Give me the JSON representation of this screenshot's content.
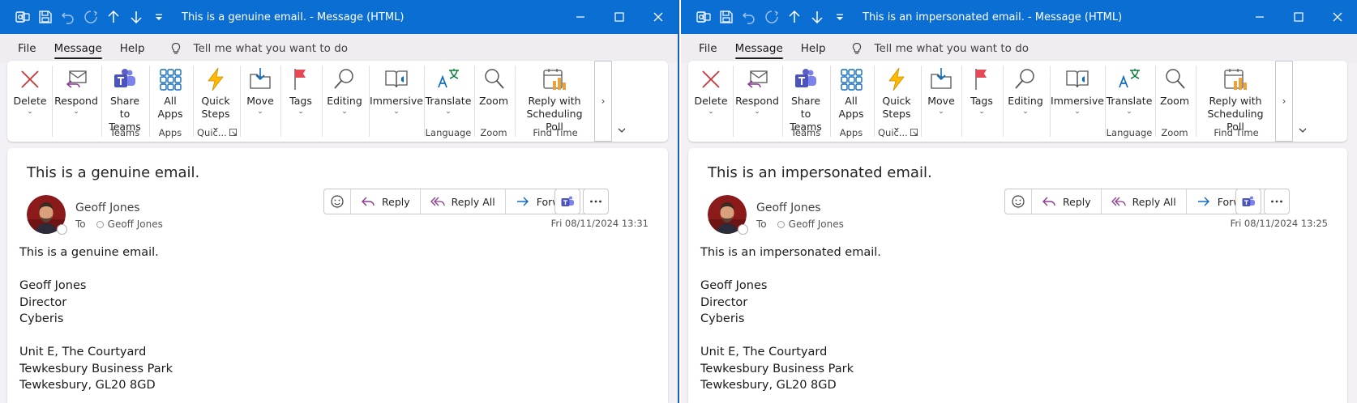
{
  "colors": {
    "titlebar": "#0b6ed3",
    "accent": "#0f6cbd",
    "delete_red": "#d13438",
    "teams_purple": "#5b5fc7"
  },
  "windows": [
    {
      "title": "This is a genuine email.  -  Message (HTML)",
      "menu": [
        "File",
        "Message",
        "Help"
      ],
      "active_menu": "Message",
      "tell_me": "Tell me what you want to do",
      "ribbon": {
        "delete": "Delete",
        "respond": "Respond",
        "share_teams_1": "Share to",
        "share_teams_2": "Teams",
        "all_apps_1": "All",
        "all_apps_2": "Apps",
        "quick_steps_1": "Quick",
        "quick_steps_2": "Steps",
        "move": "Move",
        "tags": "Tags",
        "editing": "Editing",
        "immersive": "Immersive",
        "translate": "Translate",
        "zoom": "Zoom",
        "reply_poll_1": "Reply with",
        "reply_poll_2": "Scheduling Poll",
        "groups": {
          "teams": "Teams",
          "apps": "Apps",
          "quick": "Quic...",
          "language": "Language",
          "zoom": "Zoom",
          "find_time": "Find Time"
        },
        "scroll": "›"
      },
      "subject": "This is a genuine email.",
      "sender": "Geoff Jones",
      "to_label": "To",
      "recipient": "Geoff Jones",
      "actions": {
        "reply": "Reply",
        "reply_all": "Reply All",
        "forward": "Forward"
      },
      "datetime": "Fri 08/11/2024 13:31",
      "body": [
        "This is a genuine email.",
        "",
        "Geoff Jones",
        "Director",
        "Cyberis",
        "",
        "Unit E, The Courtyard",
        "Tewkesbury Business Park",
        "Tewkesbury, GL20 8GD"
      ]
    },
    {
      "title": "This is an impersonated email.  -  Message (HTML)",
      "menu": [
        "File",
        "Message",
        "Help"
      ],
      "active_menu": "Message",
      "tell_me": "Tell me what you want to do",
      "ribbon": {
        "delete": "Delete",
        "respond": "Respond",
        "share_teams_1": "Share to",
        "share_teams_2": "Teams",
        "all_apps_1": "All",
        "all_apps_2": "Apps",
        "quick_steps_1": "Quick",
        "quick_steps_2": "Steps",
        "move": "Move",
        "tags": "Tags",
        "editing": "Editing",
        "immersive": "Immersive",
        "translate": "Translate",
        "zoom": "Zoom",
        "reply_poll_1": "Reply with",
        "reply_poll_2": "Scheduling Poll",
        "groups": {
          "teams": "Teams",
          "apps": "Apps",
          "quick": "Quic...",
          "language": "Language",
          "zoom": "Zoom",
          "find_time": "Find Time"
        },
        "scroll": "›"
      },
      "subject": "This is an impersonated email.",
      "sender": "Geoff Jones",
      "to_label": "To",
      "recipient": "Geoff Jones",
      "actions": {
        "reply": "Reply",
        "reply_all": "Reply All",
        "forward": "Forward"
      },
      "datetime": "Fri 08/11/2024 13:25",
      "body": [
        "This is an impersonated email.",
        "",
        "Geoff Jones",
        "Director",
        "Cyberis",
        "",
        "Unit E, The Courtyard",
        "Tewkesbury Business Park",
        "Tewkesbury, GL20 8GD"
      ]
    }
  ]
}
